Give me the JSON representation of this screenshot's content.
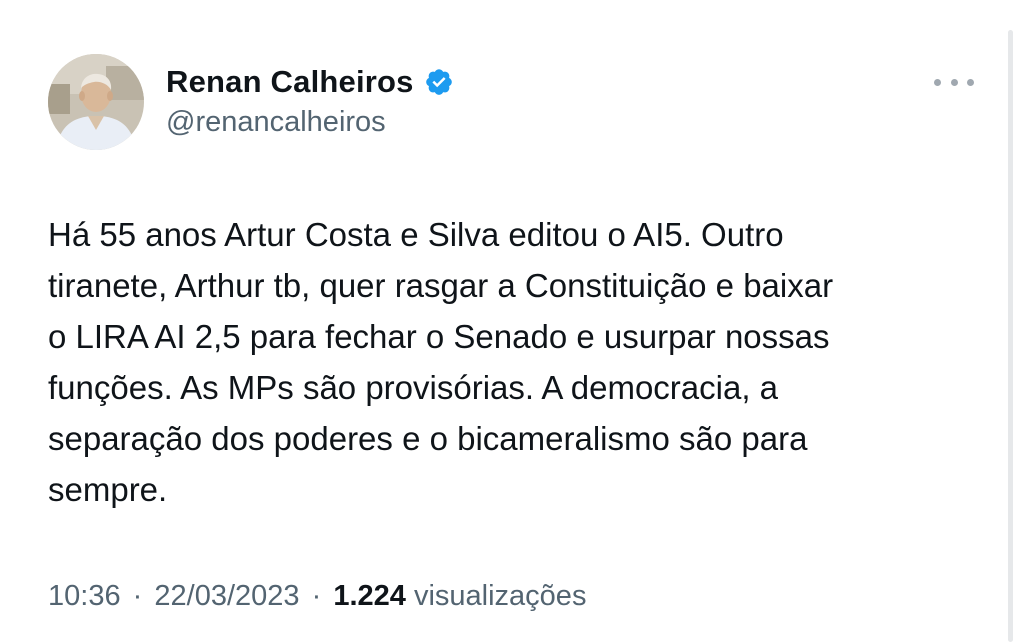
{
  "author": {
    "display_name": "Renan Calheiros",
    "handle": "@renancalheiros",
    "verified": true,
    "avatar_icon": "profile-photo",
    "verified_icon": "verified-badge-icon",
    "verified_color": "#1d9bf0"
  },
  "tweet": {
    "text_lines": [
      "Há 55 anos Artur Costa e Silva editou o AI5. Outro",
      "tiranete, Arthur tb, quer rasgar a Constituição e baixar",
      "o LIRA AI 2,5 para fechar o Senado e usurpar nossas",
      "funções. As MPs são provisórias. A democracia, a",
      "separação dos poderes e o bicameralismo são para",
      "sempre."
    ]
  },
  "meta": {
    "time": "10:36",
    "separator": "·",
    "date": "22/03/2023",
    "views_count": "1.224",
    "views_label": "visualizações"
  },
  "more_icon": "more-options-icon",
  "colors": {
    "text": "#0f1419",
    "secondary": "#536471",
    "accent": "#1d9bf0"
  }
}
